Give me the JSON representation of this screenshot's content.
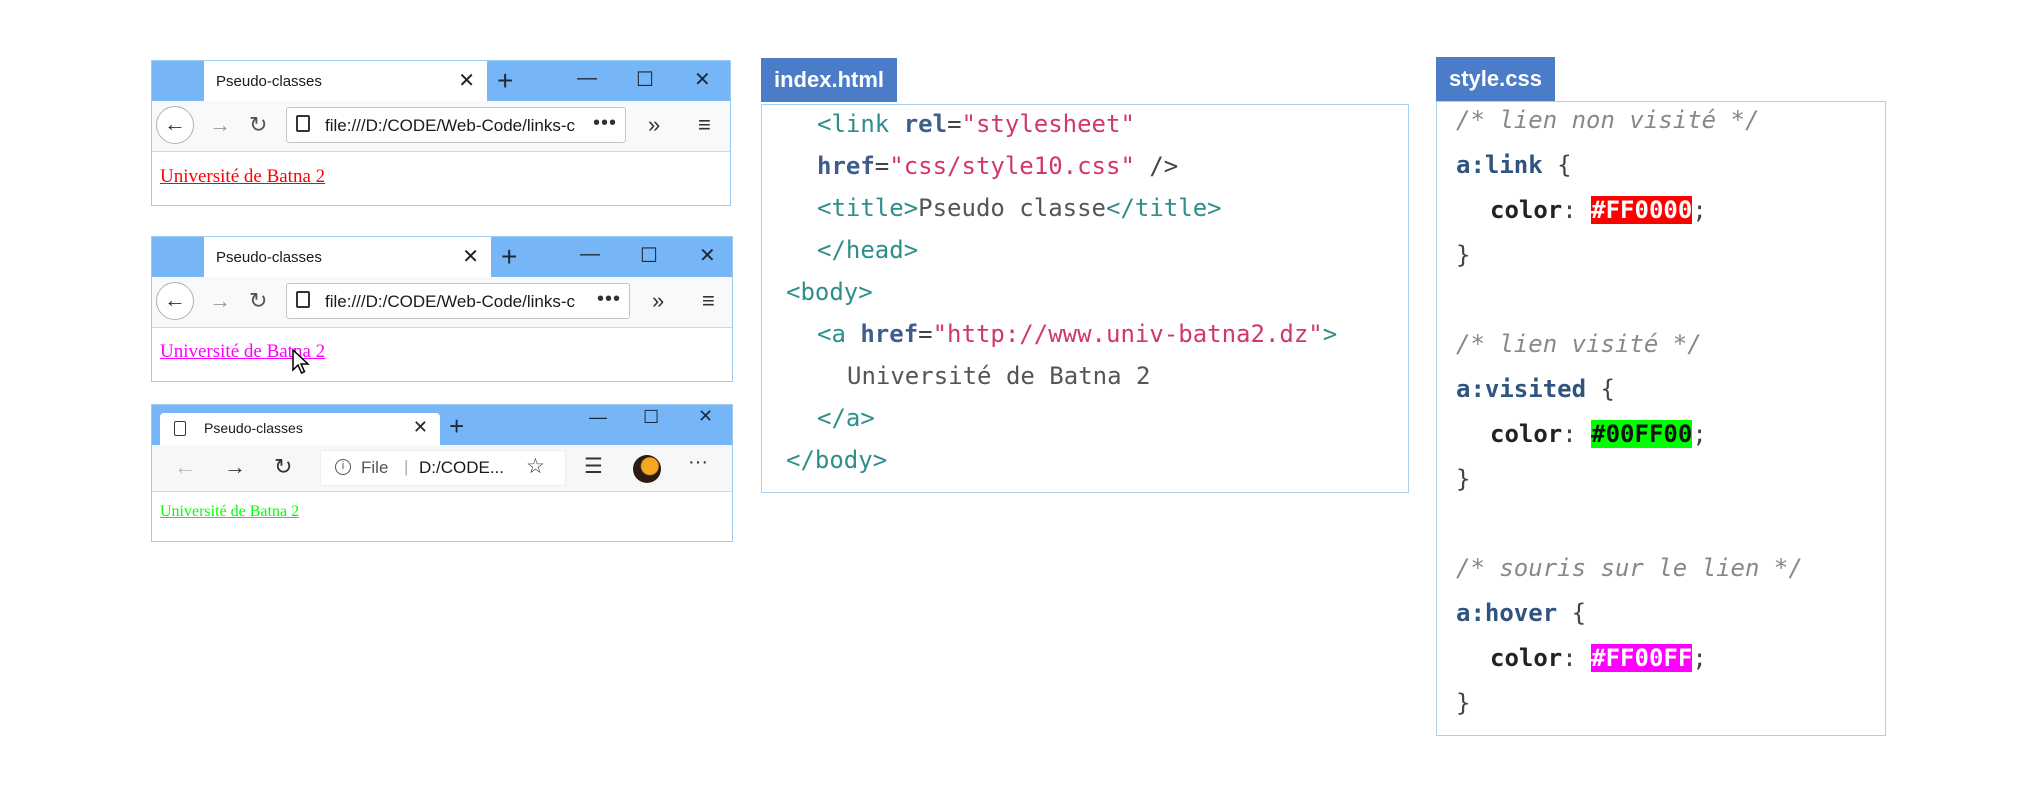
{
  "browser1": {
    "tab_title": "Pseudo-classes",
    "url": "file:///D:/CODE/Web-Code/links-c",
    "link_text": "Université de Batna 2",
    "link_color": "#FF0000"
  },
  "browser2": {
    "tab_title": "Pseudo-classes",
    "url": "file:///D:/CODE/Web-Code/links-c",
    "link_text": "Université de Batna 2",
    "link_color": "#FF00FF"
  },
  "browser3": {
    "tab_title": "Pseudo-classes",
    "url_scheme": "File",
    "url": "D:/CODE...",
    "link_text": "Université de Batna 2",
    "link_color": "#00FF00"
  },
  "html_panel": {
    "title": "index.html",
    "lines": {
      "l1": {
        "a": "<link",
        "b": "rel",
        "c": "=",
        "d": "\"stylesheet\""
      },
      "l2": {
        "a": "href",
        "b": "=",
        "c": "\"css/style10.css\"",
        "d": " />"
      },
      "l3": {
        "a": "<title>",
        "b": "Pseudo classe",
        "c": "</title>"
      },
      "l4": {
        "a": "</head>"
      },
      "l5": {
        "a": "<body>"
      },
      "l6": {
        "a": "<a",
        "b": "href",
        "c": "=",
        "d": "\"http://www.univ-batna2.dz\"",
        "e": ">"
      },
      "l7": {
        "a": "Université de Batna 2"
      },
      "l8": {
        "a": "</a>"
      },
      "l9": {
        "a": "</body>"
      }
    }
  },
  "css_panel": {
    "title": "style.css",
    "comment_link": "/* lien non visité */",
    "sel_link": "a:link",
    "comment_visited": "/* lien visité */",
    "sel_visited": "a:visited",
    "comment_hover": "/* souris sur le lien */",
    "sel_hover": "a:hover",
    "open_brace": "{",
    "close_brace": "}",
    "prop": "color",
    "colon": ":",
    "semicolon": ";",
    "color_link": "#FF0000",
    "color_visited": "#00FF00",
    "color_hover": "#FF00FF"
  }
}
